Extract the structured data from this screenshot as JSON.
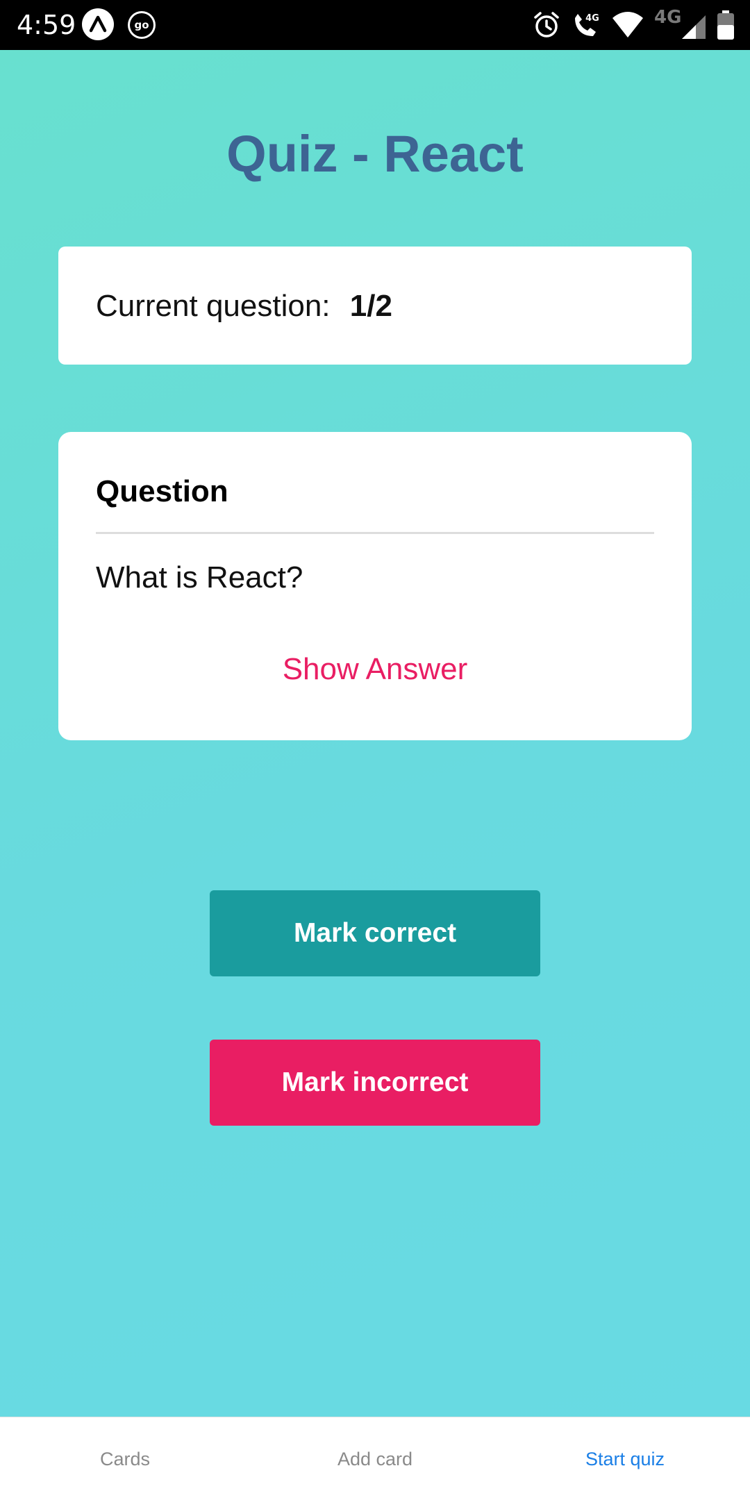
{
  "status_bar": {
    "time": "4:59",
    "icons": [
      "expo-icon",
      "go-icon",
      "alarm-icon",
      "volte-call-icon",
      "wifi-icon",
      "cell-signal-4g-icon",
      "battery-icon"
    ],
    "network_label": "4G",
    "call_label": "4G"
  },
  "header": {
    "title": "Quiz - React"
  },
  "progress": {
    "label": "Current question:",
    "value": "1/2"
  },
  "question_card": {
    "heading": "Question",
    "text": "What is React?",
    "show_answer_label": "Show Answer"
  },
  "actions": {
    "correct_label": "Mark correct",
    "incorrect_label": "Mark incorrect"
  },
  "bottom_nav": {
    "items": [
      {
        "label": "Cards",
        "active": false
      },
      {
        "label": "Add card",
        "active": false
      },
      {
        "label": "Start quiz",
        "active": true
      }
    ]
  },
  "colors": {
    "title": "#3d6493",
    "accent_pink": "#e91e63",
    "teal_button": "#1a9c9e",
    "nav_inactive": "#8a8a8a",
    "nav_active": "#1b7fe6"
  }
}
